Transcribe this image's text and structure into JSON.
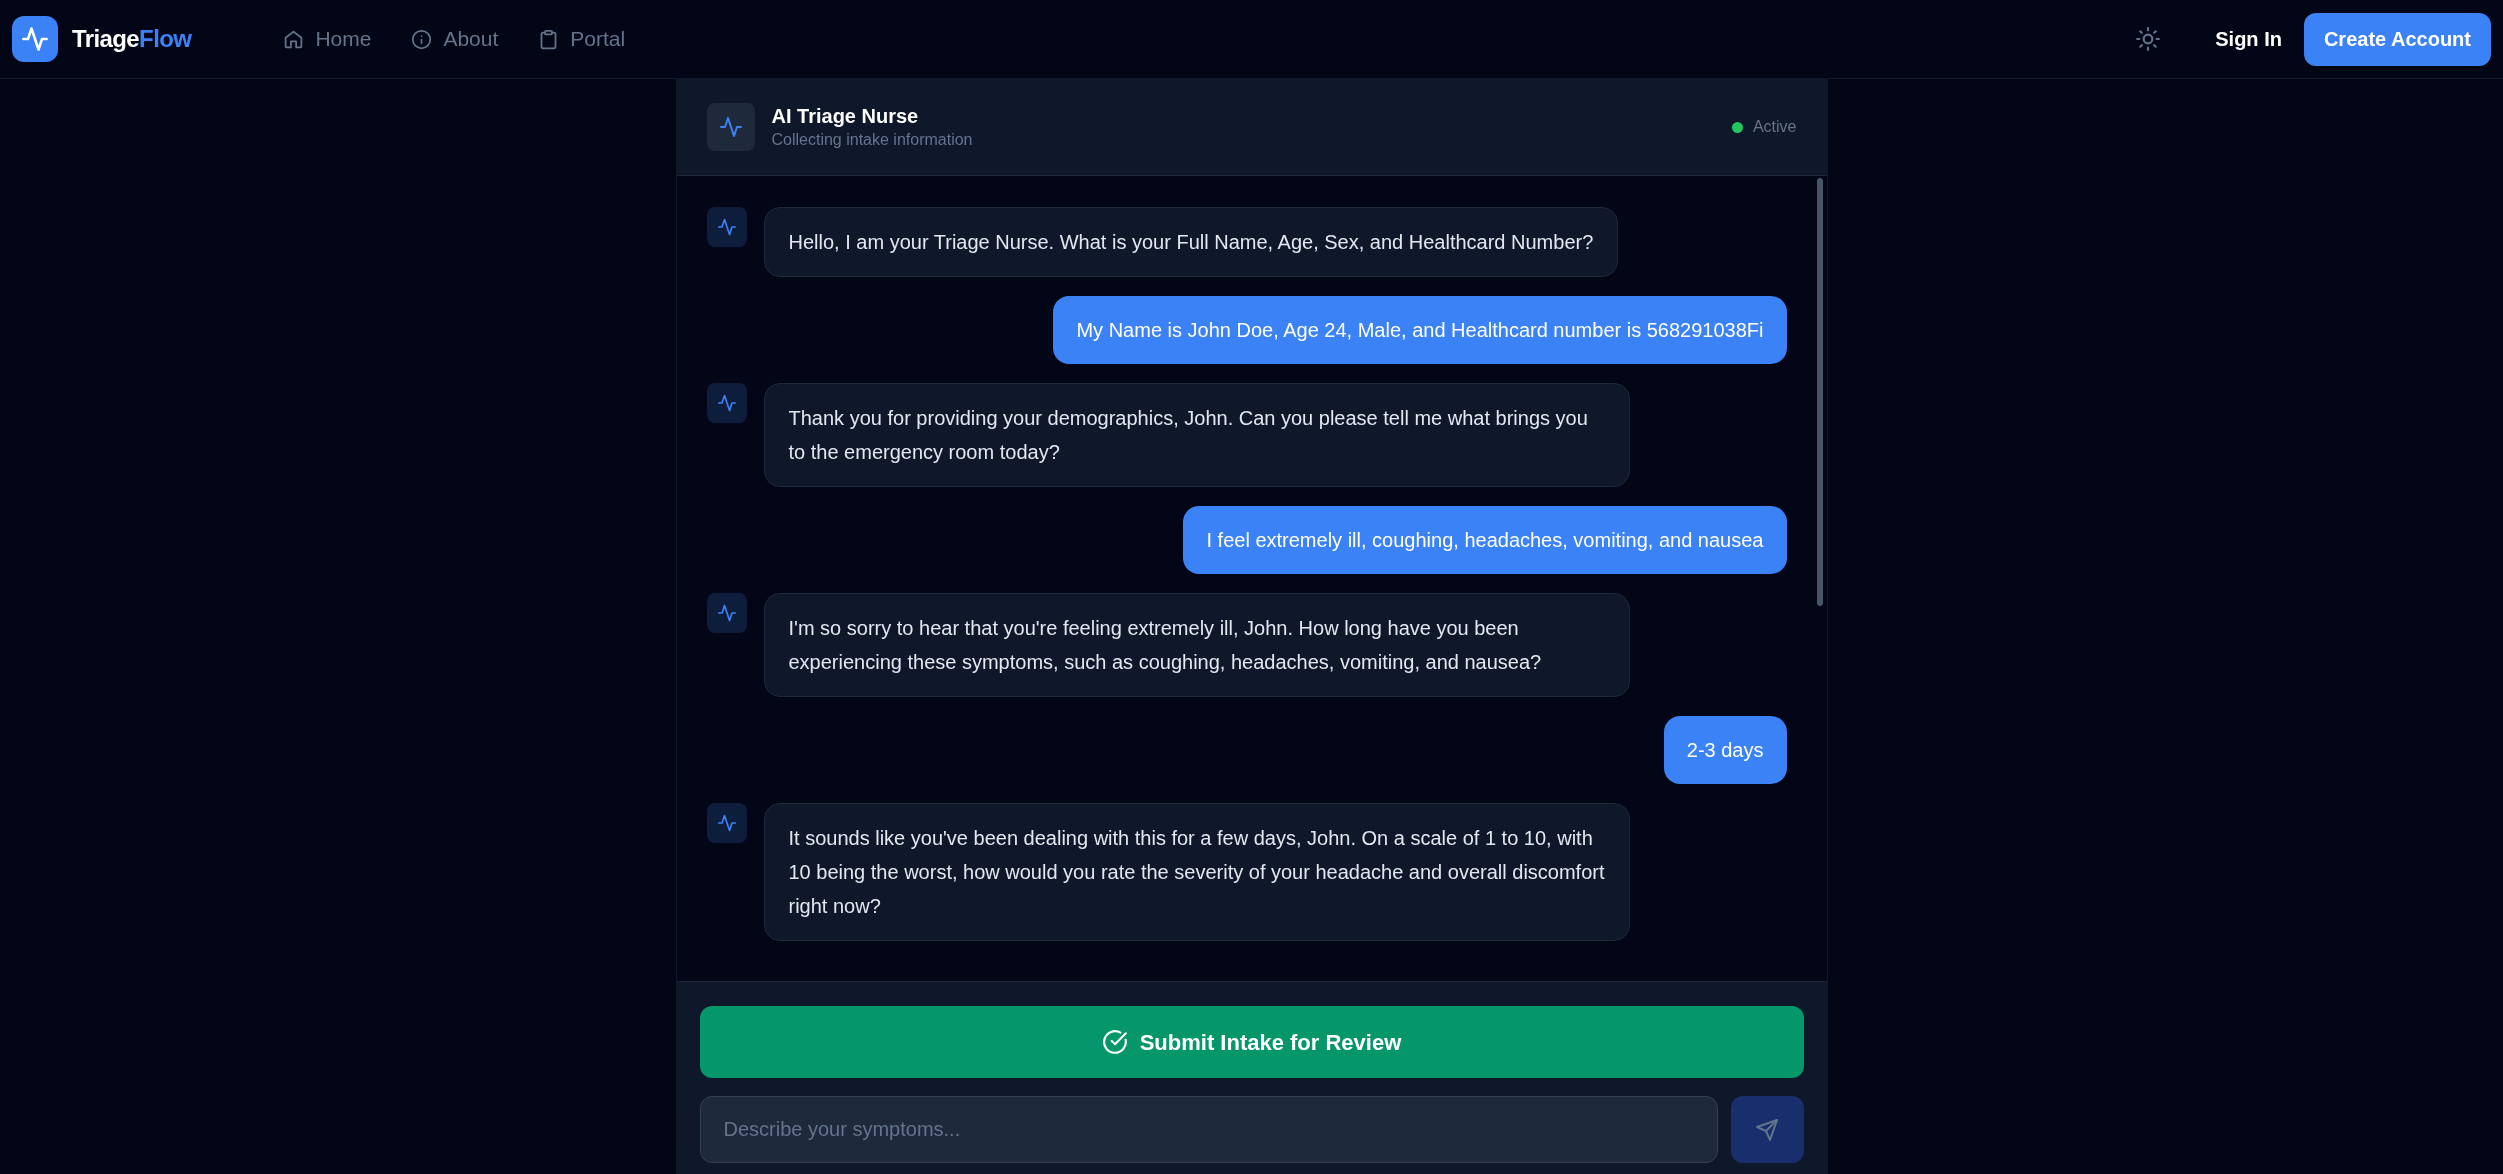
{
  "brand": {
    "first": "Triage",
    "second": "Flow"
  },
  "nav": [
    {
      "label": "Home"
    },
    {
      "label": "About"
    },
    {
      "label": "Portal"
    }
  ],
  "actions": {
    "sign_in": "Sign In",
    "create_account": "Create Account"
  },
  "chat_header": {
    "title": "AI Triage Nurse",
    "subtitle": "Collecting intake information",
    "status": {
      "label": "Active",
      "online": true
    }
  },
  "messages": [
    {
      "kind": "bot",
      "text": "Hello, I am your Triage Nurse. What is your Full Name, Age, Sex, and Healthcard Number?"
    },
    {
      "kind": "user",
      "text": "My Name is John Doe, Age 24, Male, and Healthcard number is 568291038Fi"
    },
    {
      "kind": "bot",
      "text": "Thank you for providing your demographics, John. Can you please tell me what brings you to the emergency room today?"
    },
    {
      "kind": "user",
      "text": "I feel extremely ill, coughing, headaches, vomiting, and nausea"
    },
    {
      "kind": "bot",
      "text": "I'm so sorry to hear that you're feeling extremely ill, John. How long have you been experiencing these symptoms, such as coughing, headaches, vomiting, and nausea?"
    },
    {
      "kind": "user",
      "text": "2-3 days"
    },
    {
      "kind": "bot",
      "text": "It sounds like you've been dealing with this for a few days, John. On a scale of 1 to 10, with 10 being the worst, how would you rate the severity of your headache and overall discomfort right now?"
    }
  ],
  "submit_button": "Submit Intake for Review",
  "input": {
    "placeholder": "Describe your symptoms..."
  }
}
